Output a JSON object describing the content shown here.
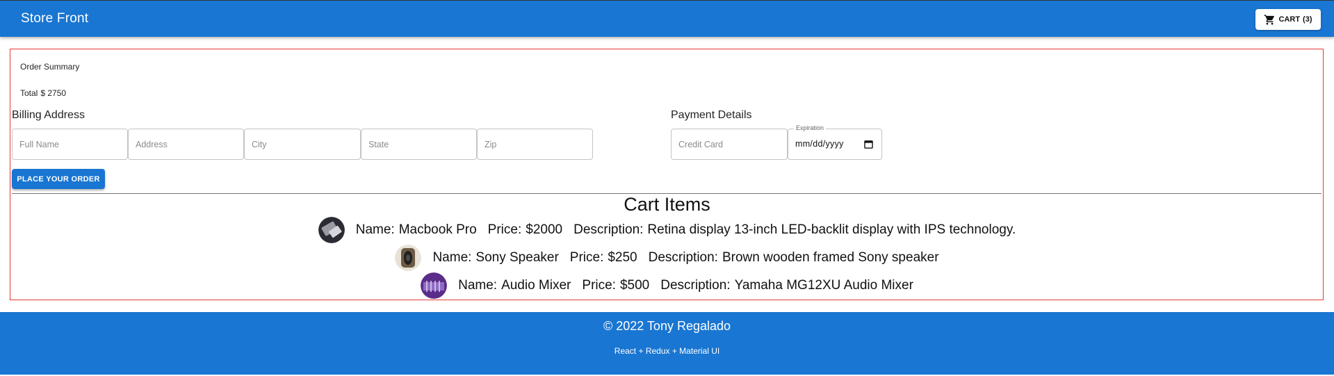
{
  "header": {
    "brand": "Store Front",
    "cart_label": "CART",
    "cart_count": "(3)"
  },
  "order": {
    "title": "Order Summary",
    "total_label": "Total",
    "total_value": "$ 2750"
  },
  "billing": {
    "title": "Billing Address",
    "fields": {
      "full_name": {
        "placeholder": "Full Name",
        "value": ""
      },
      "address": {
        "placeholder": "Address",
        "value": ""
      },
      "city": {
        "placeholder": "City",
        "value": ""
      },
      "state": {
        "placeholder": "State",
        "value": ""
      },
      "zip": {
        "placeholder": "Zip",
        "value": ""
      }
    }
  },
  "payment": {
    "title": "Payment Details",
    "credit_card": {
      "placeholder": "Credit Card",
      "value": ""
    },
    "expiration": {
      "label": "Expiration",
      "display": "mm/dd/yyyy"
    }
  },
  "place_order_label": "PLACE YOUR ORDER",
  "cart_items": {
    "title": "Cart Items",
    "name_label": "Name:",
    "price_label": "Price:",
    "desc_label": "Description:",
    "items": [
      {
        "name": "Macbook Pro",
        "price": "$2000",
        "description": "Retina display 13-inch LED-backlit display with IPS technology.",
        "thumb_color": "#3a3a44"
      },
      {
        "name": "Sony Speaker",
        "price": "$250",
        "description": "Brown wooden framed Sony speaker",
        "thumb_color": "#6b5a44"
      },
      {
        "name": "Audio Mixer",
        "price": "$500",
        "description": "Yamaha MG12XU Audio Mixer",
        "thumb_color": "#5b2d8a"
      }
    ]
  },
  "footer": {
    "copyright": "© 2022 Tony Regalado",
    "tech": "React + Redux + Material UI"
  },
  "colors": {
    "primary": "#1976d2",
    "outline": "#e53935"
  },
  "icons": {
    "cart": "shopping-cart-icon",
    "calendar": "calendar-icon"
  }
}
